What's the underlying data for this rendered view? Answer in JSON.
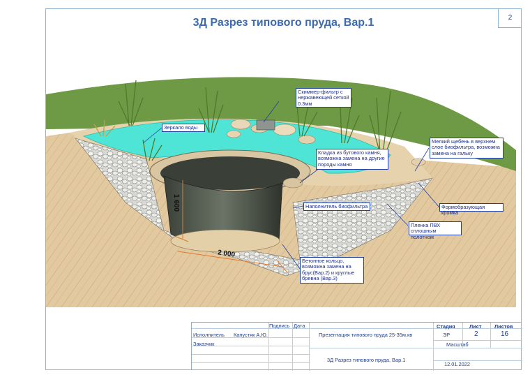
{
  "sheet_number": "2",
  "title": "3Д Разрез типового пруда, Вар.1",
  "callouts": {
    "mirror": "Зеркало воды",
    "skimmer": "Скиммер-фильтр с нержавеющей сеткой 0.3мм",
    "masonry": "Кладка из бутового камня, возможна замена на другие породы камня",
    "gravel": "Мелкий щебень в верхнем слое биофильтра, возможна замена на гальку",
    "filler": "Наполнитель биофильтра",
    "edge": "Формобразующая кромка",
    "pvc": "Пленка ПВХ сплошным полотном",
    "ring": "Бетонное кольцо, возможна замена на брус(Вар.2) и круглые бревна (Вар.3)"
  },
  "dimensions": {
    "height": "1 600",
    "width": "2 000"
  },
  "title_block": {
    "col_podpis": "Подпись",
    "col_data": "Дата",
    "role_executor": "Исполнитель",
    "executor_name": "Капустяк А.Ю.",
    "role_customer": "Заказчик",
    "project": "Презентация типового пруда 25-35м.кв",
    "drawing_name": "3Д Разрез типового пруда, Вар.1",
    "stage_label": "Стадия",
    "sheet_label": "Лист",
    "sheets_label": "Листов",
    "stage": "ЭР",
    "sheet": "2",
    "sheets": "16",
    "scale_label": "Масштаб",
    "date": "12.01.2022"
  },
  "colors": {
    "frame": "#8fb3cf",
    "title": "#3b6ab1",
    "grass": "#6f9a45",
    "water": "#4fe5d6",
    "soil": "#dcc39b",
    "callout_border": "#1f3fa0"
  }
}
